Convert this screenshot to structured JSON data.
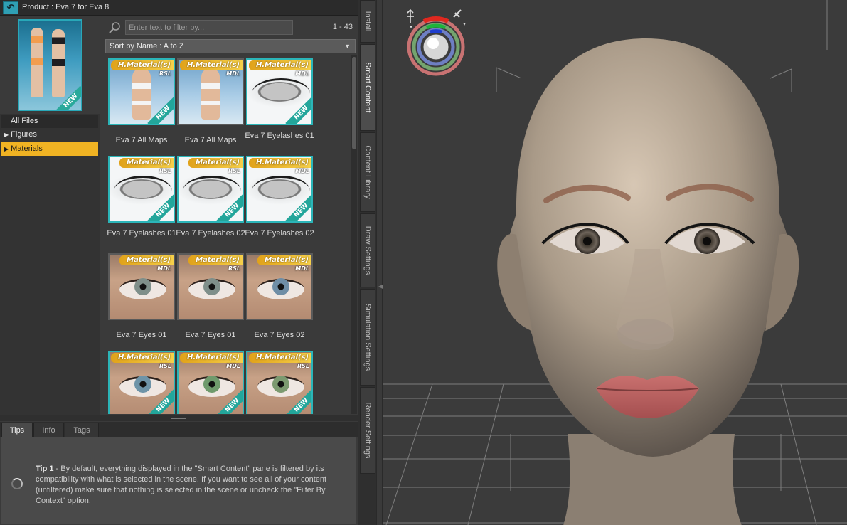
{
  "window": {
    "product_title": "Product :  Eva 7 for Eva 8"
  },
  "product": {
    "thumbnail_badge": "NEW",
    "categories": [
      {
        "label": "All Files",
        "arrow": ""
      },
      {
        "label": "Figures",
        "arrow": "▶"
      },
      {
        "label": "Materials",
        "arrow": "▶",
        "selected": true
      }
    ]
  },
  "filter": {
    "placeholder": "Enter text to filter by...",
    "count": "1 - 43"
  },
  "sort": {
    "selected": "Sort by Name : A to Z"
  },
  "grid": {
    "items": [
      {
        "label": "Eva 7 All Maps",
        "banner": "H.Material(s)",
        "tag": "RSL",
        "new": true,
        "kind": "body"
      },
      {
        "label": "Eva 7 All Maps",
        "banner": "H.Material(s)",
        "tag": "MDL",
        "new": false,
        "kind": "body"
      },
      {
        "label": "Eva 7 Eyelashes 01",
        "banner": "H.Material(s)",
        "tag": "MDL",
        "new": true,
        "kind": "lash"
      },
      {
        "label": "Eva 7 Eyelashes 01",
        "banner": "Material(s)",
        "tag": "RSL",
        "new": true,
        "kind": "lash"
      },
      {
        "label": "Eva 7 Eyelashes 02",
        "banner": "Material(s)",
        "tag": "RSL",
        "new": true,
        "kind": "lash"
      },
      {
        "label": "Eva 7 Eyelashes 02",
        "banner": "H.Material(s)",
        "tag": "MDL",
        "new": true,
        "kind": "lash"
      },
      {
        "label": "Eva 7 Eyes 01",
        "banner": "Material(s)",
        "tag": "MDL",
        "new": false,
        "kind": "eye",
        "iris": "#7f8f8a"
      },
      {
        "label": "Eva 7 Eyes 01",
        "banner": "Material(s)",
        "tag": "RSL",
        "new": false,
        "kind": "eye",
        "iris": "#7f8f8a"
      },
      {
        "label": "Eva 7 Eyes 02",
        "banner": "Material(s)",
        "tag": "MDL",
        "new": false,
        "kind": "eye",
        "iris": "#6f8ea6"
      },
      {
        "label": "",
        "banner": "H.Material(s)",
        "tag": "RSL",
        "new": true,
        "kind": "eye",
        "iris": "#6e94a8"
      },
      {
        "label": "",
        "banner": "H.Material(s)",
        "tag": "MDL",
        "new": true,
        "kind": "eye",
        "iris": "#6f9a6c"
      },
      {
        "label": "",
        "banner": "H.Material(s)",
        "tag": "RSL",
        "new": true,
        "kind": "eye",
        "iris": "#7c9a70"
      }
    ]
  },
  "tips": {
    "tabs": [
      "Tips",
      "Info",
      "Tags"
    ],
    "active_tab": "Tips",
    "tip_title": "Tip 1",
    "tip_text": " - By default, everything displayed in the \"Smart Content\" pane is filtered by its compatibility with what is selected in the scene. If you want to see all of your content (unfiltered) make sure that nothing is selected in the scene or uncheck the \"Filter By Context\" option."
  },
  "side_tabs": [
    {
      "label": "Install",
      "active": false
    },
    {
      "label": "Smart Content",
      "active": true
    },
    {
      "label": "Content Library",
      "active": false
    },
    {
      "label": "Draw Settings",
      "active": false
    },
    {
      "label": "Simulation Settings",
      "active": false
    },
    {
      "label": "Render Settings",
      "active": false
    }
  ],
  "colors": {
    "accent_selection": "#f0b323",
    "tile_border": "#2bb5b8",
    "back_button": "#2f9fb4"
  },
  "icons": {
    "back": "back-arrow-icon",
    "filter": "magnifier-icon",
    "sort": "chevron-down-icon",
    "busy": "spinner-icon",
    "camera_navigation": "navigation-gizmo-icon"
  }
}
